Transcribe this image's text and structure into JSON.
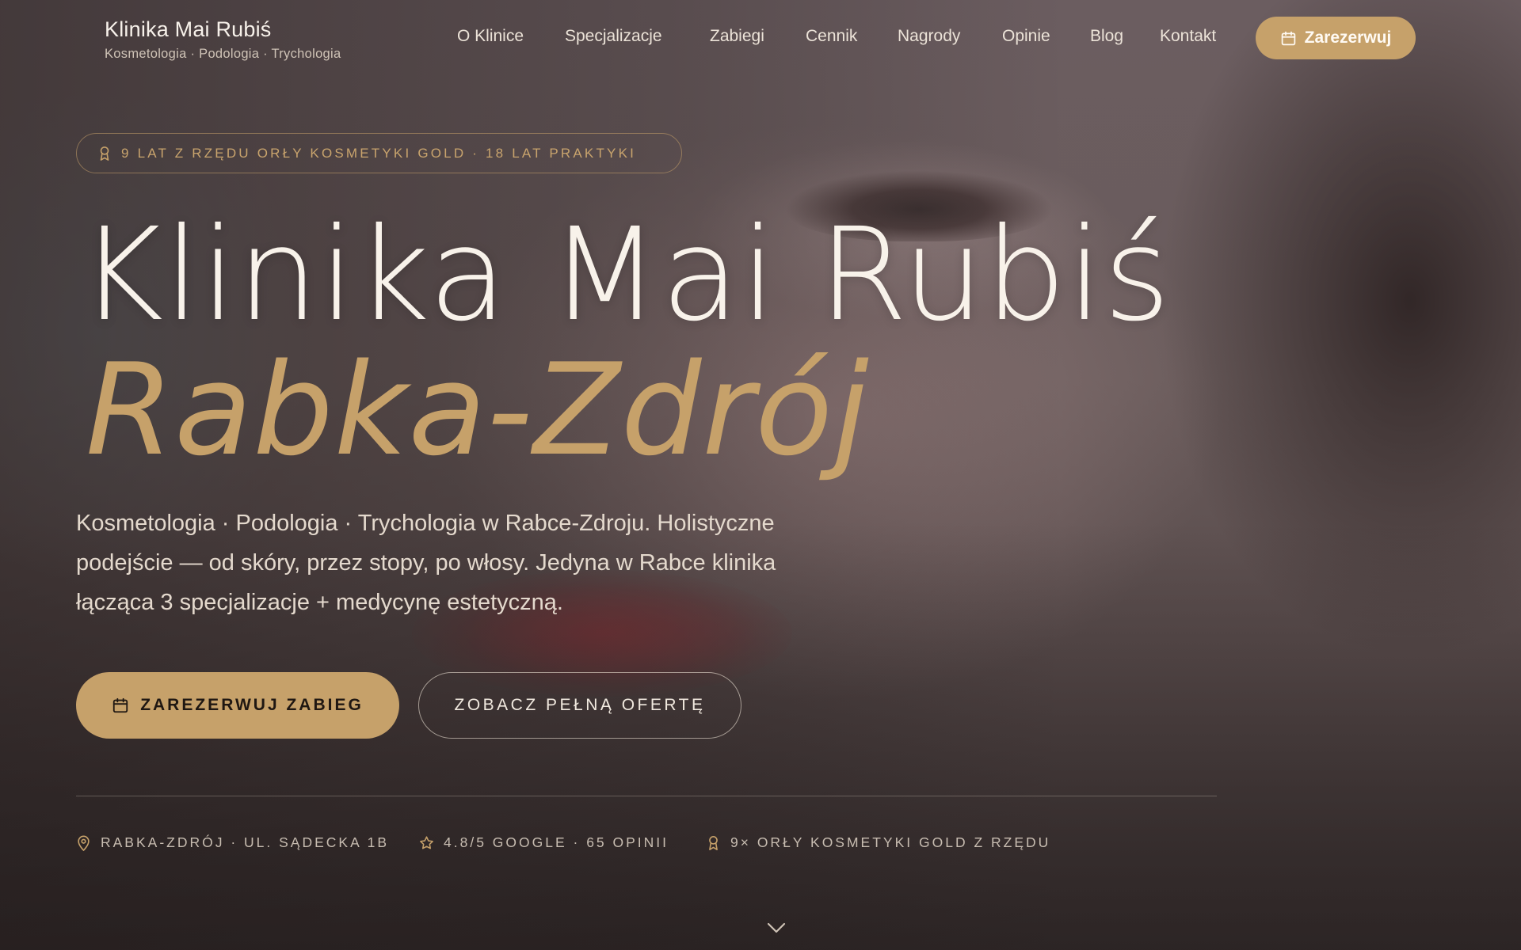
{
  "brand": {
    "name": "Klinika Mai Rubiś",
    "tagline": "Kosmetologia · Podologia · Trychologia"
  },
  "nav": {
    "items": [
      "O Klinice",
      "Specjalizacje",
      "Zabiegi",
      "Cennik",
      "Nagrody",
      "Opinie",
      "Blog",
      "Kontakt"
    ],
    "cta_label": "Zarezerwuj",
    "cta_icon": "calendar-icon"
  },
  "hero": {
    "badge": "9 LAT Z RZĘDU ORŁY KOSMETYKI GOLD · 18 LAT PRAKTYKI",
    "badge_icon": "award-icon",
    "title": "Klinika Mai Rubiś",
    "title_accent": "Rabka-Zdrój",
    "lead": "Kosmetologia · Podologia · Trychologia w Rabce-Zdroju. Holistyczne podejście — od skóry, przez stopy, po włosy. Jedyna w Rabce klinika łącząca 3 specjalizacje + medycynę estetyczną.",
    "primary_button": "ZAREZERWUJ ZABIEG",
    "secondary_button": "ZOBACZ PEŁNĄ OFERTĘ"
  },
  "facts": [
    {
      "icon": "map-pin-icon",
      "text": "RABKA-ZDRÓJ · UL. SĄDECKA 1B"
    },
    {
      "icon": "star-icon",
      "text": "4.8/5 GOOGLE · 65 OPINII"
    },
    {
      "icon": "award-icon",
      "text": "9× ORŁY KOSMETYKI GOLD Z RZĘDU"
    }
  ],
  "colors": {
    "accent": "#c6a16a",
    "text_light": "#f8f2ea",
    "text_muted": "#c8bdb1"
  }
}
